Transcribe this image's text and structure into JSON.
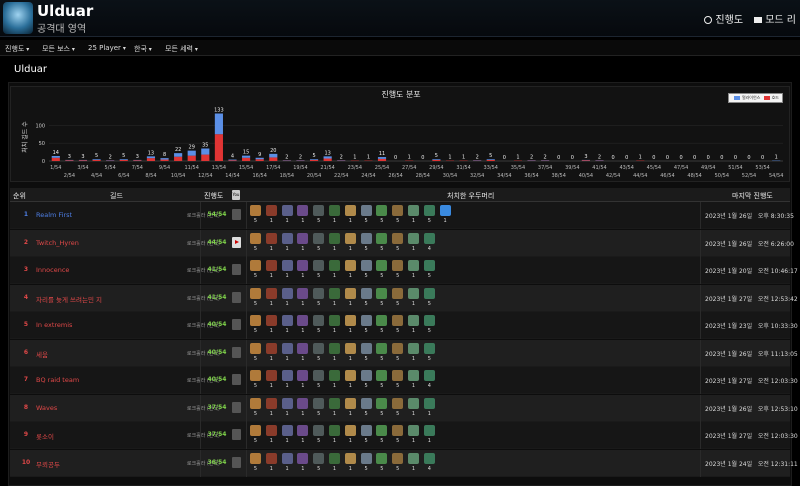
{
  "header": {
    "title": "Ulduar",
    "subtitle": "공격대 영역",
    "language": "진행도",
    "other": "모드 리"
  },
  "nav": [
    "진행도",
    "모든 보스",
    "25 Player",
    "한국",
    "모든 세력"
  ],
  "section_title": "Ulduar",
  "chart_data": {
    "type": "bar",
    "title": "진행도 분포",
    "ylabel": "처치 길드 수",
    "ylim": [
      0,
      140
    ],
    "yticks": [
      0,
      50,
      100
    ],
    "categories": [
      "1/54",
      "2/54",
      "3/54",
      "4/54",
      "5/54",
      "6/54",
      "7/54",
      "8/54",
      "9/54",
      "10/54",
      "11/54",
      "12/54",
      "13/54",
      "14/54",
      "15/54",
      "16/54",
      "17/54",
      "18/54",
      "19/54",
      "20/54",
      "21/54",
      "22/54",
      "23/54",
      "24/54",
      "25/54",
      "26/54",
      "27/54",
      "28/54",
      "29/54",
      "30/54",
      "31/54",
      "32/54",
      "33/54",
      "34/54",
      "35/54",
      "36/54",
      "37/54",
      "38/54",
      "39/54",
      "40/54",
      "41/54",
      "42/54",
      "43/54",
      "44/54",
      "45/54",
      "46/54",
      "47/54",
      "48/54",
      "49/54",
      "50/54",
      "51/54",
      "52/54",
      "53/54",
      "54/54"
    ],
    "totals": [
      14,
      3,
      3,
      5,
      2,
      5,
      3,
      13,
      8,
      22,
      29,
      35,
      133,
      4,
      15,
      9,
      20,
      2,
      2,
      5,
      13,
      2,
      1,
      1,
      11,
      0,
      1,
      0,
      5,
      1,
      1,
      2,
      5,
      0,
      1,
      2,
      2,
      0,
      0,
      3,
      2,
      0,
      0,
      1,
      0,
      0,
      0,
      0,
      0,
      0,
      0,
      0,
      0,
      1
    ],
    "series": [
      {
        "name": "얼라이언스",
        "color": "#5b8fe6",
        "values": [
          5,
          1,
          1,
          2,
          1,
          2,
          1,
          5,
          4,
          10,
          14,
          17,
          58,
          2,
          6,
          4,
          10,
          1,
          1,
          2,
          6,
          1,
          0,
          0,
          5,
          0,
          0,
          0,
          2,
          0,
          0,
          1,
          2,
          0,
          0,
          1,
          1,
          0,
          0,
          1,
          1,
          0,
          0,
          0,
          0,
          0,
          0,
          0,
          0,
          0,
          0,
          0,
          0,
          1
        ]
      },
      {
        "name": "호드",
        "color": "#e03434",
        "values": [
          9,
          2,
          2,
          3,
          1,
          3,
          2,
          8,
          4,
          12,
          15,
          18,
          75,
          2,
          9,
          5,
          10,
          1,
          1,
          3,
          7,
          1,
          1,
          1,
          6,
          0,
          1,
          0,
          3,
          1,
          1,
          1,
          3,
          0,
          1,
          1,
          1,
          0,
          0,
          2,
          1,
          0,
          0,
          1,
          0,
          0,
          0,
          0,
          0,
          0,
          0,
          0,
          0,
          0
        ]
      }
    ],
    "legend": "top-right"
  },
  "table": {
    "headers": {
      "rank": "순위",
      "guild": "길드",
      "progress": "진행도",
      "kills": "처치한 우두머리",
      "last": "마지막 진행도"
    },
    "yt_label": "You Tube",
    "rows": [
      {
        "rank": "1",
        "name": "Realm First",
        "color": "#4e7fe6",
        "realm": "로크홀라 (한국)",
        "progress": "54/54",
        "yt": false,
        "kills": [
          "5",
          "1",
          "1",
          "1",
          "5",
          "1",
          "1",
          "5",
          "5",
          "5",
          "1",
          "5",
          "1"
        ],
        "date": "2023년 1월 26일",
        "time": "오후 8:30:35"
      },
      {
        "rank": "2",
        "name": "Twitch_Hyren",
        "color": "#e04848",
        "realm": "로크홀라 (한국)",
        "progress": "44/54",
        "yt": true,
        "kills": [
          "5",
          "1",
          "1",
          "1",
          "5",
          "1",
          "1",
          "5",
          "5",
          "5",
          "1",
          "4"
        ],
        "date": "2023년 1월 26일",
        "time": "오전 6:26:00"
      },
      {
        "rank": "3",
        "name": "Innocence",
        "color": "#e04848",
        "realm": "로크홀라 (한국)",
        "progress": "41/54",
        "yt": false,
        "kills": [
          "5",
          "1",
          "1",
          "1",
          "5",
          "1",
          "1",
          "5",
          "5",
          "5",
          "1",
          "5"
        ],
        "date": "2023년 1월 20일",
        "time": "오전 10:46:17"
      },
      {
        "rank": "4",
        "name": "자리를 늦게 쓰려는민 지",
        "color": "#e04848",
        "realm": "로크홀라 (한국)",
        "progress": "41/54",
        "yt": false,
        "kills": [
          "5",
          "1",
          "1",
          "1",
          "5",
          "1",
          "1",
          "5",
          "5",
          "5",
          "1",
          "5"
        ],
        "date": "2023년 1월 27일",
        "time": "오전 12:53:42"
      },
      {
        "rank": "5",
        "name": "In extremis",
        "color": "#e04848",
        "realm": "로크홀라 (한국)",
        "progress": "40/54",
        "yt": false,
        "kills": [
          "5",
          "1",
          "1",
          "1",
          "5",
          "1",
          "1",
          "5",
          "5",
          "5",
          "1",
          "5"
        ],
        "date": "2023년 1월 23일",
        "time": "오후 10:33:30"
      },
      {
        "rank": "6",
        "name": "세움",
        "color": "#e04848",
        "realm": "로크홀라 (한국)",
        "progress": "40/54",
        "yt": false,
        "kills": [
          "5",
          "1",
          "1",
          "1",
          "5",
          "1",
          "1",
          "5",
          "5",
          "5",
          "1",
          "5"
        ],
        "date": "2023년 1월 26일",
        "time": "오후 11:13:05"
      },
      {
        "rank": "7",
        "name": "BQ raid team",
        "color": "#e04848",
        "realm": "로크홀라 (한국)",
        "progress": "40/54",
        "yt": false,
        "kills": [
          "5",
          "1",
          "1",
          "1",
          "5",
          "1",
          "1",
          "5",
          "5",
          "5",
          "1",
          "4"
        ],
        "date": "2023년 1월 27일",
        "time": "오전 12:03:30"
      },
      {
        "rank": "8",
        "name": "Waves",
        "color": "#e04848",
        "realm": "로크홀라 (한국)",
        "progress": "37/54",
        "yt": false,
        "kills": [
          "5",
          "1",
          "1",
          "1",
          "5",
          "1",
          "1",
          "5",
          "5",
          "5",
          "1",
          "1"
        ],
        "date": "2023년 1월 26일",
        "time": "오후 12:53:10"
      },
      {
        "rank": "9",
        "name": "롯소이",
        "color": "#e04848",
        "realm": "로크홀라 (한국)",
        "progress": "37/54",
        "yt": false,
        "kills": [
          "5",
          "1",
          "1",
          "1",
          "5",
          "1",
          "1",
          "5",
          "5",
          "5",
          "1",
          "1"
        ],
        "date": "2023년 1월 27일",
        "time": "오전 12:03:30"
      },
      {
        "rank": "10",
        "name": "무뢰공두",
        "color": "#e04848",
        "realm": "로크홀라 (한국)",
        "progress": "36/54",
        "yt": false,
        "kills": [
          "5",
          "1",
          "1",
          "1",
          "5",
          "1",
          "1",
          "5",
          "5",
          "5",
          "1",
          "4"
        ],
        "date": "2023년 1월 24일",
        "time": "오전 12:31:11"
      }
    ]
  },
  "boss_icon_colors": [
    "#b07a3a",
    "#8a3b2a",
    "#5a5f8a",
    "#6a4a8a",
    "#4f5a5a",
    "#3a6a3a",
    "#b08a4a",
    "#6a7a8a",
    "#4a8a4a",
    "#8a6a3a",
    "#5a8a6a",
    "#3a7a5a",
    "#3a8ae0"
  ]
}
